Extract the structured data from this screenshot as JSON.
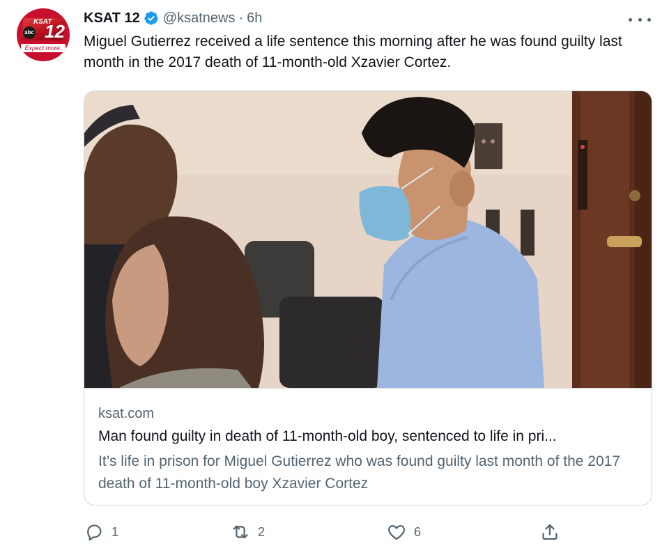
{
  "tweet": {
    "display_name": "KSAT 12",
    "handle": "@ksatnews",
    "separator": "·",
    "time": "6h",
    "text": "Miguel Gutierrez received a life sentence this morning after he was found guilty last month in the 2017 death of 11-month-old Xzavier Cortez.",
    "avatar": {
      "logo_top": "KSAT",
      "logo_number": "12",
      "logo_network": "abc",
      "logo_tagline": "Expect more."
    }
  },
  "card": {
    "domain": "ksat.com",
    "title": "Man found guilty in death of 11-month-old boy, sentenced to life in pri...",
    "description": "It’s life in prison for Miguel Gutierrez who was found guilty last month of the 2017 death of 11-month-old boy Xzavier Cortez"
  },
  "actions": {
    "reply_count": "1",
    "retweet_count": "2",
    "like_count": "6"
  },
  "icons": [
    "verified-badge-icon",
    "more-icon",
    "reply-icon",
    "retweet-icon",
    "like-icon",
    "share-icon"
  ],
  "colors": {
    "text_primary": "#0f1419",
    "text_secondary": "#536471",
    "verified_blue": "#1d9bf0",
    "border": "#cfd9de",
    "brand_red": "#c8102e"
  }
}
